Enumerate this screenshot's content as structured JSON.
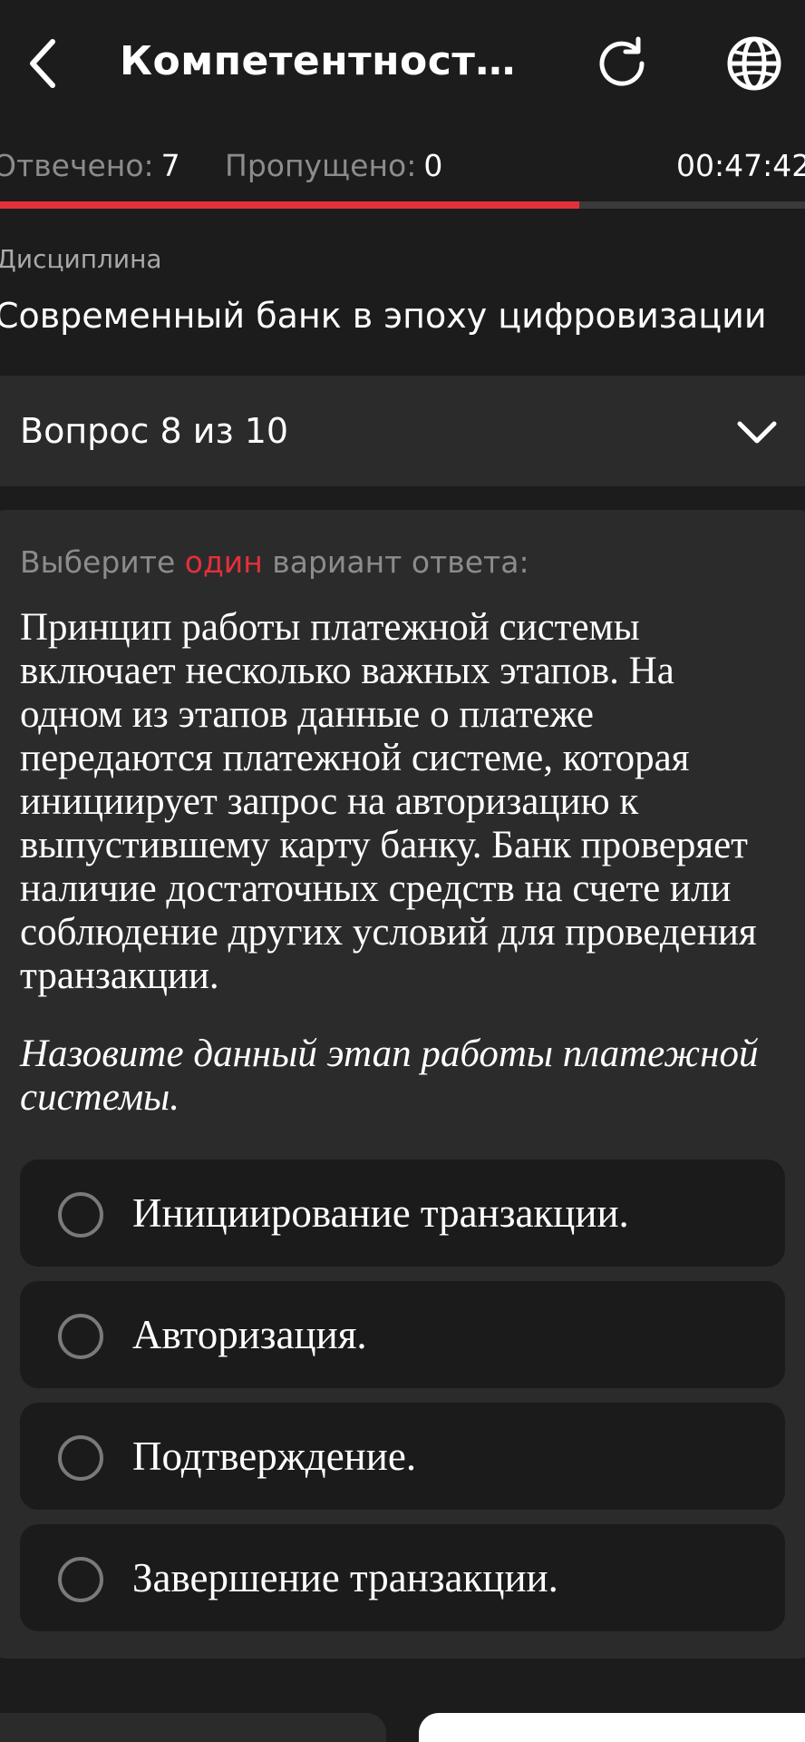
{
  "header": {
    "title": "Компетентностны...",
    "back_icon": "chevron-left-icon",
    "reload_icon": "reload-icon",
    "language_icon": "globe-icon"
  },
  "stats": {
    "answered_label": "Отвечено:",
    "answered_value": "7",
    "skipped_label": "Пропущено:",
    "skipped_value": "0",
    "timer": "00:47:42"
  },
  "progress": {
    "fraction": 0.72,
    "fill_color": "#e3303b"
  },
  "discipline": {
    "label": "Дисциплина",
    "name": "Современный банк в эпоху цифровизации"
  },
  "question_selector": {
    "label": "Вопрос 8 из 10",
    "icon": "chevron-down-icon"
  },
  "question": {
    "instruction_prefix": "Выберите ",
    "instruction_accent": "один",
    "instruction_suffix": " вариант ответа:",
    "text": "Принцип работы платежной системы включает несколько важных этапов. На одном из этапов данные о платеже передаются платежной системе, которая инициирует запрос на авторизацию к выпустившему карту банку. Банк проверяет наличие достаточных средств на счете или соблюдение других условий для проведения транзакции.",
    "ask": "Назовите данный этап работы платежной системы.",
    "options": [
      {
        "label": "Инициирование транзакции."
      },
      {
        "label": "Авторизация."
      },
      {
        "label": "Подтверждение."
      },
      {
        "label": "Завершение транзакции."
      }
    ]
  },
  "colors": {
    "background": "#1c1c1d",
    "card": "#2b2b2c",
    "accent": "#e3303b"
  }
}
